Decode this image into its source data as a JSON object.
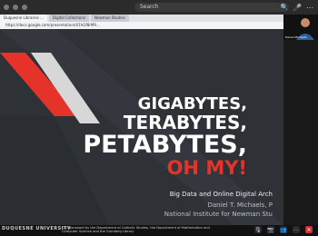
{
  "topbar": {
    "search_text": "Search"
  },
  "browser": {
    "tabs": [
      "Duquesne Libraries ...",
      "Digital Collections",
      "Newman Studies"
    ],
    "url": "https://docs.google.com/presentation/d/1hGf8rM9..."
  },
  "slide": {
    "title_lines": [
      "Gigabytes,",
      "Terabytes,",
      "Petabytes,",
      "Oh My!"
    ],
    "subtitle": "Big Data and Online Digital Arch",
    "author": "Daniel T. Michaels, P",
    "institution": "National Institute for Newman Stu"
  },
  "participant": {
    "name": "Daniel Michaels"
  },
  "footer": {
    "logo": "DUQUESNE UNIVERSITY",
    "sponsor": "Co-sponsored by the Department of Catholic Studies, the Department of Mathematics and Computer Science and the Gumberg Library"
  },
  "colors": {
    "accent": "#e6332a",
    "slide_bg": "#2e3136"
  }
}
